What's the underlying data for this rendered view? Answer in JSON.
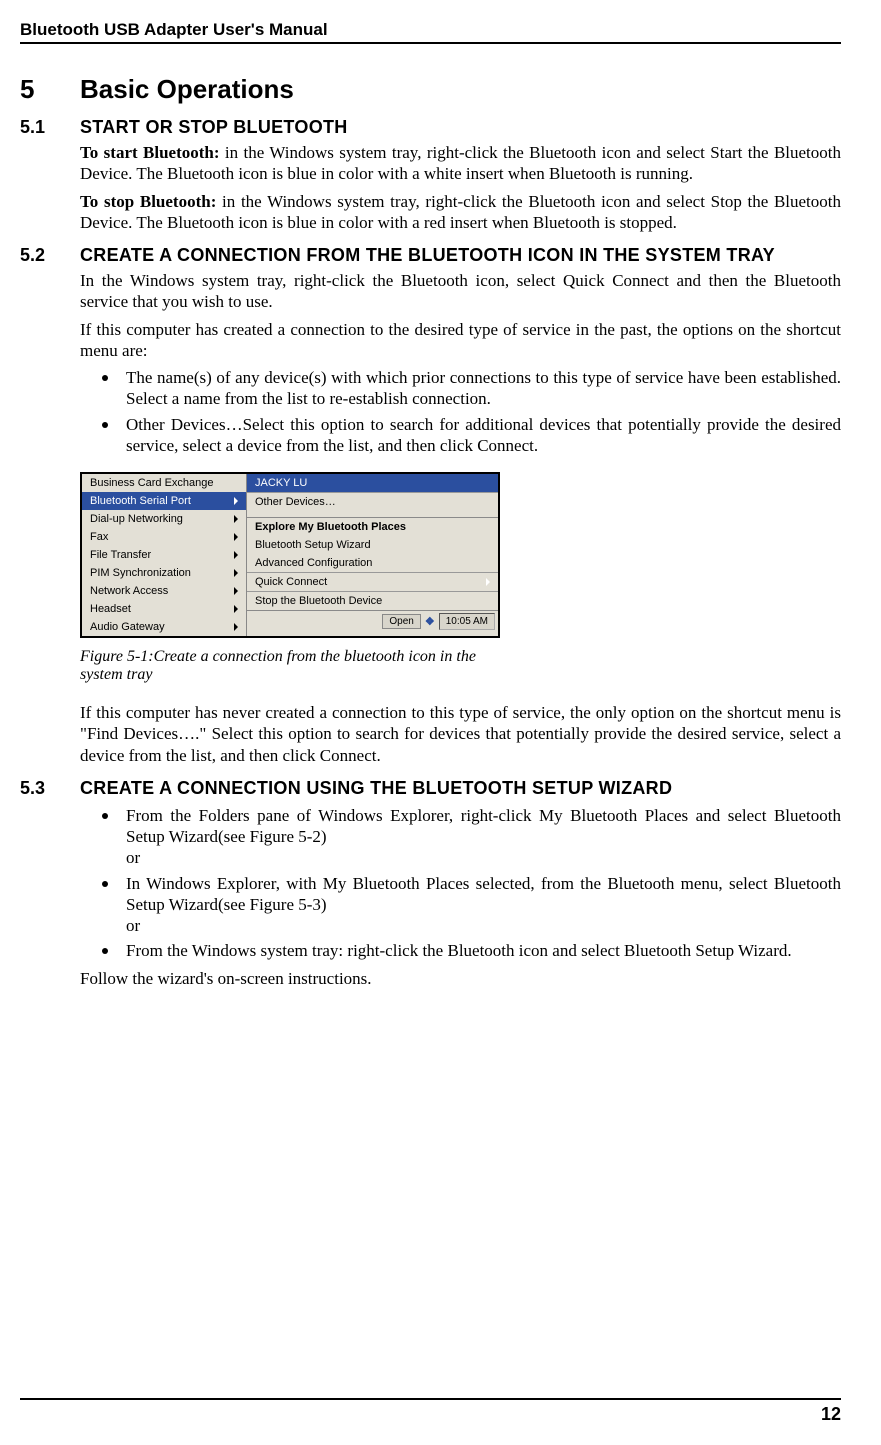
{
  "header": {
    "title": "Bluetooth USB Adapter User's Manual"
  },
  "chapter": {
    "num": "5",
    "title": "Basic Operations"
  },
  "s1": {
    "num": "5.1",
    "title": "START OR STOP BLUETOOTH",
    "p1_bold": "To start Bluetooth:",
    "p1_rest": " in the Windows system tray, right-click the Bluetooth icon and select Start the Bluetooth Device. The Bluetooth icon is blue in color with a white insert when Bluetooth is running.",
    "p2_bold": "To stop Bluetooth:",
    "p2_rest": " in the Windows system tray, right-click the Bluetooth icon and select Stop the Bluetooth Device. The Bluetooth icon is blue in color with a red insert when Bluetooth is stopped."
  },
  "s2": {
    "num": "5.2",
    "title": "CREATE A CONNECTION FROM THE BLUETOOTH ICON IN THE SYSTEM TRAY",
    "p1": "In the Windows system tray, right-click the Bluetooth icon, select Quick Connect and then the Bluetooth service that you wish to use.",
    "p2": "If this computer has created a connection to the desired type of service in the past, the options on the shortcut menu are:",
    "b1": "The name(s) of any device(s) with which prior connections to this type of service have been established. Select a name from the list to re-establish connection.",
    "b2": "Other Devices…Select this option to search for additional devices that potentially provide the desired service, select a device from the list, and then click Connect.",
    "fig": {
      "left": [
        "Business Card Exchange",
        "Bluetooth Serial Port",
        "Dial-up Networking",
        "Fax",
        "File Transfer",
        "PIM Synchronization",
        "Network Access",
        "Headset",
        "Audio Gateway"
      ],
      "sub_hl": "JACKY LU",
      "sub_other": "Other Devices…",
      "grp_bold": "Explore My Bluetooth Places",
      "grp1": "Bluetooth Setup Wizard",
      "grp2": "Advanced Configuration",
      "quick": "Quick Connect",
      "stop": "Stop the Bluetooth Device",
      "open_btn": "Open",
      "time": "10:05 AM"
    },
    "caption": "Figure 5-1:Create a connection from the bluetooth icon in the system tray",
    "p3": "If this computer has never created a connection to this type of service, the only option on the shortcut menu is \"Find Devices….\"  Select this option to search for devices that potentially provide the desired service, select a device from the list, and then click Connect."
  },
  "s3": {
    "num": "5.3",
    "title": "CREATE A CONNECTION USING THE BLUETOOTH SETUP WIZARD",
    "b1a": "From the Folders pane of Windows Explorer, right-click My Bluetooth Places and select Bluetooth Setup Wizard(see Figure 5-2)",
    "b1b": "or",
    "b2a": "In Windows Explorer, with My Bluetooth Places selected, from the Bluetooth menu, select Bluetooth Setup Wizard(see Figure 5-3)",
    "b2b": "or",
    "b3": "From the Windows system tray: right-click the Bluetooth icon and select Bluetooth Setup Wizard.",
    "p_follow": "Follow the wizard's on-screen instructions."
  },
  "footer": {
    "page": "12"
  }
}
